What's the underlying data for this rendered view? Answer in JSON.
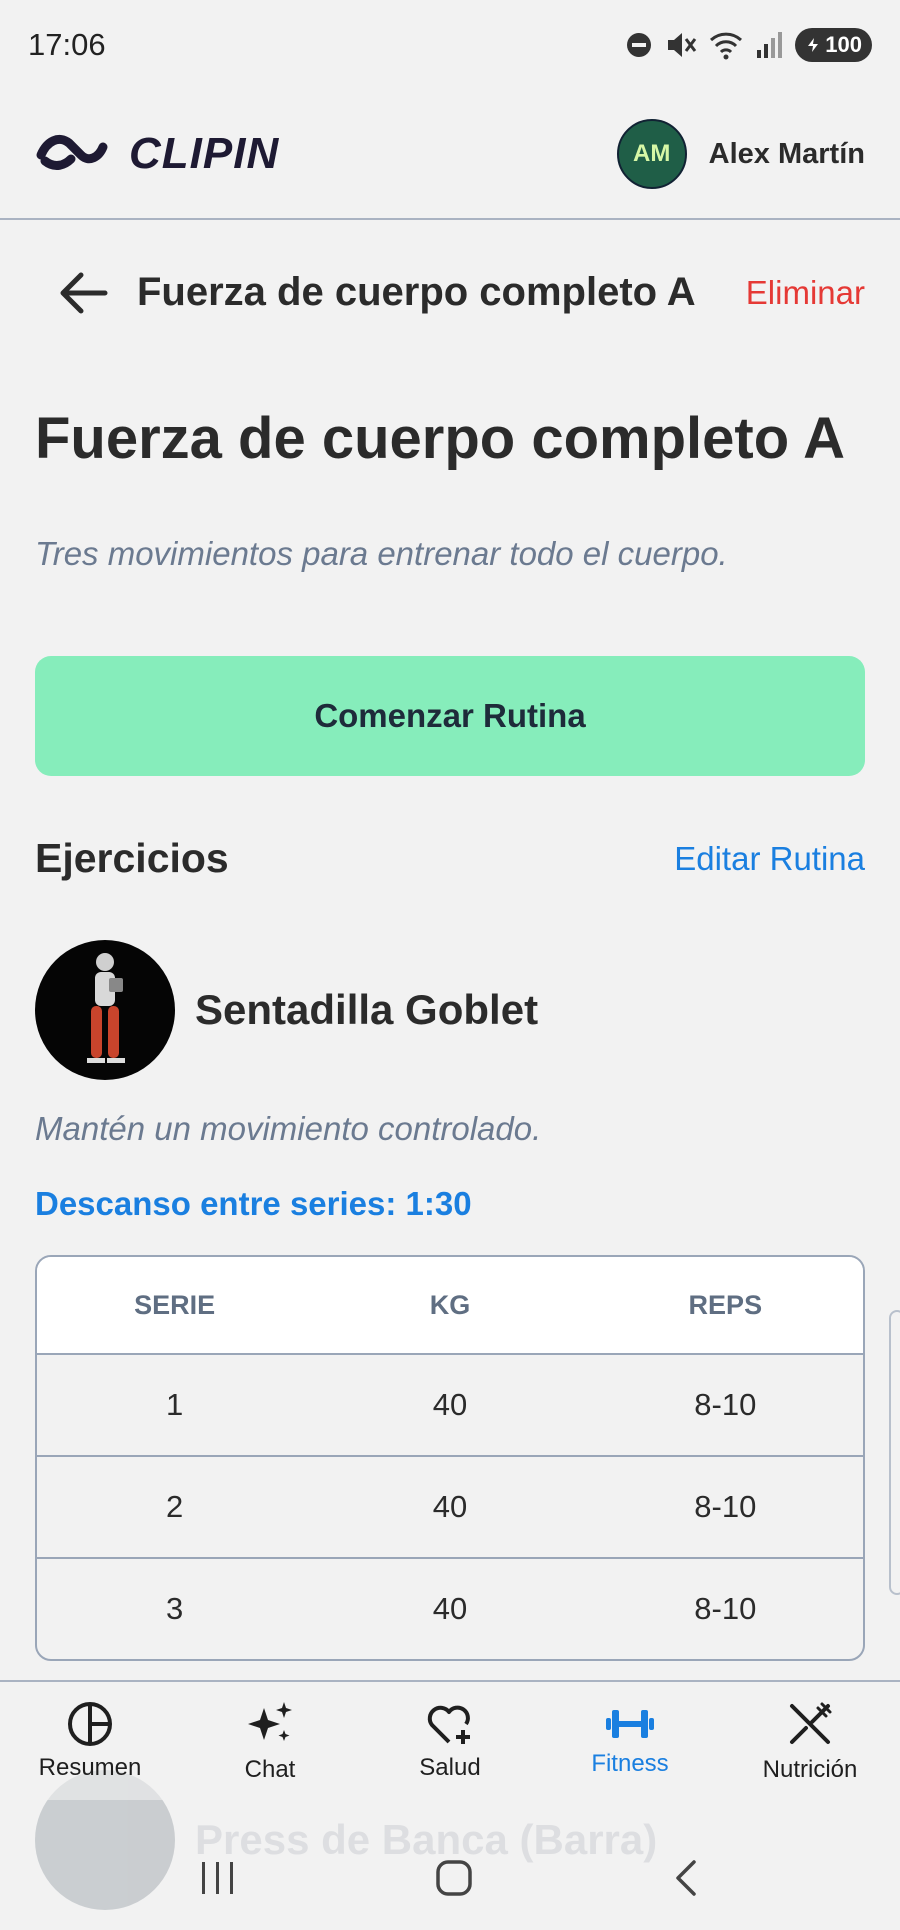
{
  "status": {
    "time": "17:06",
    "battery": "100",
    "icons": [
      "do-not-disturb-icon",
      "mute-icon",
      "wifi-icon",
      "signal-icon",
      "battery-icon"
    ]
  },
  "header": {
    "brand": "CLIPIN",
    "user_initials": "AM",
    "user_name": "Alex Martín"
  },
  "nav": {
    "title": "Fuerza de cuerpo completo A",
    "delete_label": "Eliminar"
  },
  "routine": {
    "title": "Fuerza de cuerpo completo A",
    "description": "Tres movimientos para entrenar todo el cuerpo.",
    "start_label": "Comenzar Rutina"
  },
  "exercises_section": {
    "title": "Ejercicios",
    "edit_label": "Editar Rutina"
  },
  "exercise": {
    "name": "Sentadilla Goblet",
    "note": "Mantén un movimiento controlado.",
    "rest": "Descanso entre series: 1:30",
    "columns": [
      "SERIE",
      "KG",
      "REPS"
    ],
    "sets": [
      [
        "1",
        "40",
        "8-10"
      ],
      [
        "2",
        "40",
        "8-10"
      ],
      [
        "3",
        "40",
        "8-10"
      ]
    ]
  },
  "next_exercise": {
    "name": "Press de Banca (Barra)"
  },
  "bottom_nav": {
    "tabs": [
      {
        "label": "Resumen",
        "icon": "pie-chart-icon"
      },
      {
        "label": "Chat",
        "icon": "sparkles-icon"
      },
      {
        "label": "Salud",
        "icon": "heart-plus-icon"
      },
      {
        "label": "Fitness",
        "icon": "dumbbell-icon"
      },
      {
        "label": "Nutrición",
        "icon": "utensils-icon"
      }
    ],
    "active": "Fitness"
  },
  "colors": {
    "accent": "#1a7fe0",
    "danger": "#e53935",
    "start_button": "#86edbb",
    "avatar": "#1f5e47"
  }
}
